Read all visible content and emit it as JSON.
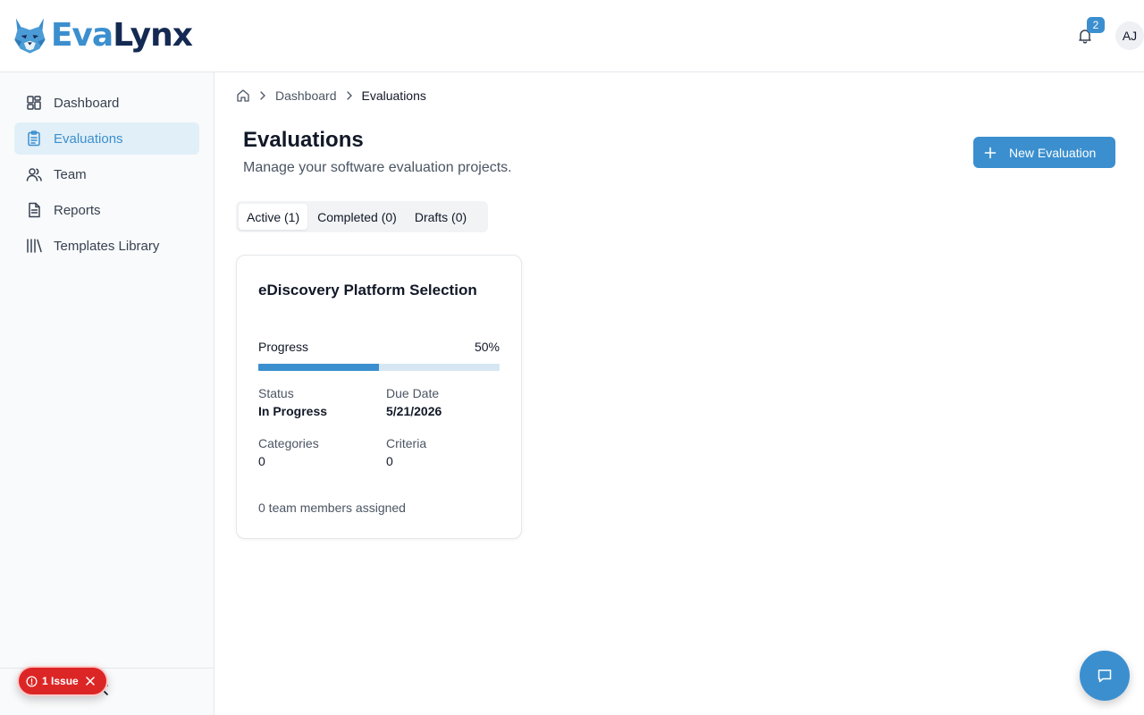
{
  "brand": {
    "eva": "Eva",
    "lynx": "Lynx",
    "logo_icon": "lynx-head-icon",
    "accent": "#3b8fcf",
    "navy": "#142a52"
  },
  "header": {
    "notification_count": "2",
    "avatar_initials": "AJ"
  },
  "sidebar": {
    "items": [
      {
        "label": "Dashboard",
        "icon": "dashboard-icon",
        "active": false
      },
      {
        "label": "Evaluations",
        "icon": "clipboard-icon",
        "active": true
      },
      {
        "label": "Team",
        "icon": "users-icon",
        "active": false
      },
      {
        "label": "Reports",
        "icon": "file-text-icon",
        "active": false
      },
      {
        "label": "Templates Library",
        "icon": "library-icon",
        "active": false
      }
    ]
  },
  "breadcrumb": {
    "parent": "Dashboard",
    "current": "Evaluations"
  },
  "page": {
    "title": "Evaluations",
    "subtitle": "Manage your software evaluation projects.",
    "new_button": "New Evaluation"
  },
  "tabs": [
    {
      "label": "Active (1)",
      "active": true
    },
    {
      "label": "Completed (0)",
      "active": false
    },
    {
      "label": "Drafts (0)",
      "active": false
    }
  ],
  "evaluation_card": {
    "title": "eDiscovery Platform Selection",
    "progress_label": "Progress",
    "progress_text": "50%",
    "progress_fraction": 0.5,
    "status_label": "Status",
    "status_value": "In Progress",
    "due_label": "Due Date",
    "due_value": "5/21/2026",
    "categories_label": "Categories",
    "categories_value": "0",
    "criteria_label": "Criteria",
    "criteria_value": "0",
    "team_text": "0 team members assigned"
  },
  "issue_badge": {
    "label": "1 Issue",
    "color": "#dc2626"
  }
}
